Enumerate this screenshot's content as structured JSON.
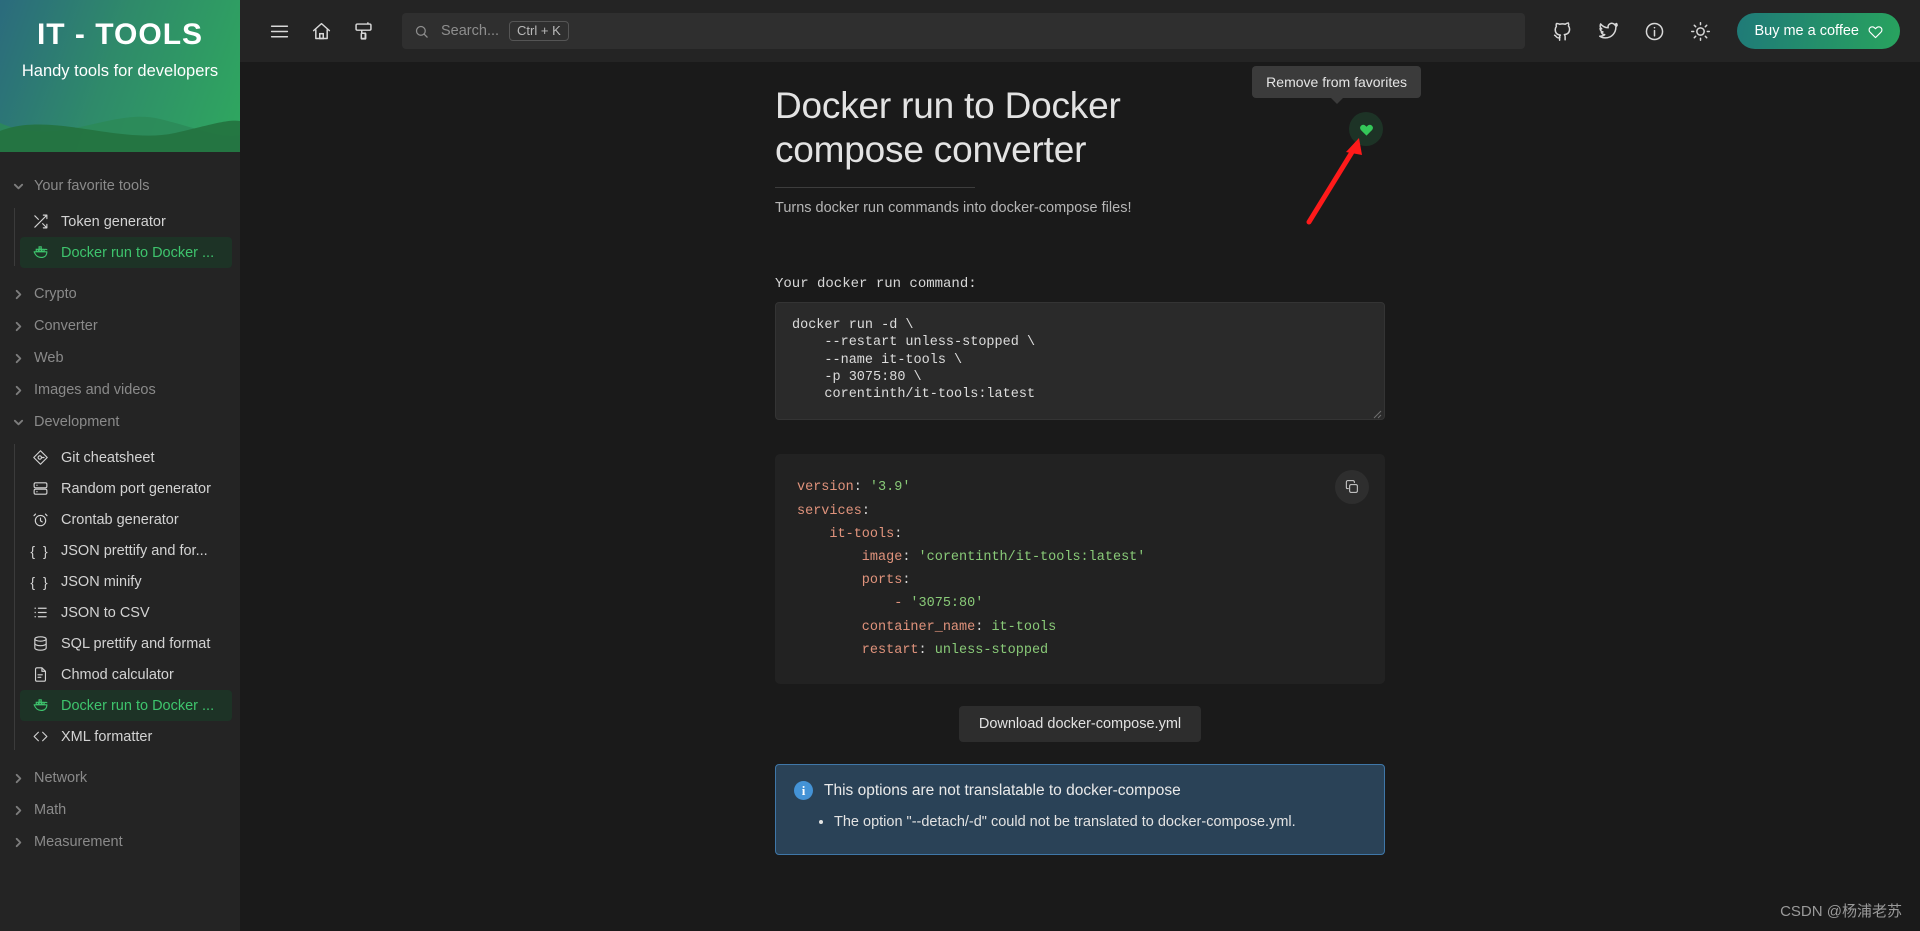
{
  "brand": {
    "title": "IT - TOOLS",
    "subtitle": "Handy tools for developers"
  },
  "sidebar": {
    "groups": [
      {
        "label": "Your favorite tools",
        "expanded": true,
        "items": [
          {
            "label": "Token generator",
            "icon": "shuffle-icon",
            "active": false
          },
          {
            "label": "Docker run to Docker ...",
            "icon": "docker-icon",
            "active": true
          }
        ]
      },
      {
        "label": "Crypto",
        "expanded": false,
        "items": []
      },
      {
        "label": "Converter",
        "expanded": false,
        "items": []
      },
      {
        "label": "Web",
        "expanded": false,
        "items": []
      },
      {
        "label": "Images and videos",
        "expanded": false,
        "items": []
      },
      {
        "label": "Development",
        "expanded": true,
        "items": [
          {
            "label": "Git cheatsheet",
            "icon": "git-icon",
            "active": false
          },
          {
            "label": "Random port generator",
            "icon": "server-icon",
            "active": false
          },
          {
            "label": "Crontab generator",
            "icon": "alarm-clock-icon",
            "active": false
          },
          {
            "label": "JSON prettify and for...",
            "icon": "braces-icon",
            "active": false
          },
          {
            "label": "JSON minify",
            "icon": "braces-icon",
            "active": false
          },
          {
            "label": "JSON to CSV",
            "icon": "list-icon",
            "active": false
          },
          {
            "label": "SQL prettify and format",
            "icon": "database-icon",
            "active": false
          },
          {
            "label": "Chmod calculator",
            "icon": "file-icon",
            "active": false
          },
          {
            "label": "Docker run to Docker ...",
            "icon": "docker-icon",
            "active": true
          },
          {
            "label": "XML formatter",
            "icon": "code-icon",
            "active": false
          }
        ]
      },
      {
        "label": "Network",
        "expanded": false,
        "items": []
      },
      {
        "label": "Math",
        "expanded": false,
        "items": []
      },
      {
        "label": "Measurement",
        "expanded": false,
        "items": []
      }
    ]
  },
  "topbar": {
    "menu_icon": "hamburger-menu-icon",
    "home_icon": "home-icon",
    "theme_icon": "paint-brush-icon",
    "search": {
      "placeholder": "Search...",
      "shortcut": "Ctrl + K"
    },
    "icons": [
      "github-icon",
      "twitter-icon",
      "info-icon",
      "sun-icon"
    ],
    "coffee_button": "Buy me a coffee"
  },
  "page": {
    "title": "Docker run to Docker compose converter",
    "description": "Turns docker run commands into docker-compose files!",
    "favorite_tooltip": "Remove from favorites",
    "favorite_icon": "heart-icon",
    "input_label": "Your docker run command:",
    "input_value": "docker run -d \\\n    --restart unless-stopped \\\n    --name it-tools \\\n    -p 3075:80 \\\n    corentinth/it-tools:latest",
    "copy_icon": "copy-icon",
    "yaml": [
      [
        {
          "t": "version",
          "c": "key"
        },
        {
          "t": ": ",
          "c": "plain"
        },
        {
          "t": "'3.9'",
          "c": "str"
        }
      ],
      [
        {
          "t": "services",
          "c": "key"
        },
        {
          "t": ":",
          "c": "plain"
        }
      ],
      [
        {
          "t": "    it-tools",
          "c": "key"
        },
        {
          "t": ":",
          "c": "plain"
        }
      ],
      [
        {
          "t": "        image",
          "c": "key"
        },
        {
          "t": ": ",
          "c": "plain"
        },
        {
          "t": "'corentinth/it-tools:latest'",
          "c": "str"
        }
      ],
      [
        {
          "t": "        ports",
          "c": "key"
        },
        {
          "t": ":",
          "c": "plain"
        }
      ],
      [
        {
          "t": "            - ",
          "c": "dash"
        },
        {
          "t": "'3075:80'",
          "c": "str"
        }
      ],
      [
        {
          "t": "        container_name",
          "c": "key"
        },
        {
          "t": ": ",
          "c": "plain"
        },
        {
          "t": "it-tools",
          "c": "str"
        }
      ],
      [
        {
          "t": "        restart",
          "c": "key"
        },
        {
          "t": ": ",
          "c": "plain"
        },
        {
          "t": "unless-stopped",
          "c": "str"
        }
      ]
    ],
    "download_button": "Download docker-compose.yml",
    "alert": {
      "icon": "info-icon",
      "title": "This options are not translatable to docker-compose",
      "items": [
        "The option \"--detach/-d\" could not be translated to docker-compose.yml."
      ]
    }
  },
  "watermark": "CSDN @杨浦老苏",
  "colors": {
    "accent_green": "#34c759",
    "active_bg": "#1d3326",
    "alert_blue": "#2a4257",
    "alert_border": "#3f77a8",
    "yaml_key": "#e0937c",
    "yaml_string": "#89ca78"
  }
}
